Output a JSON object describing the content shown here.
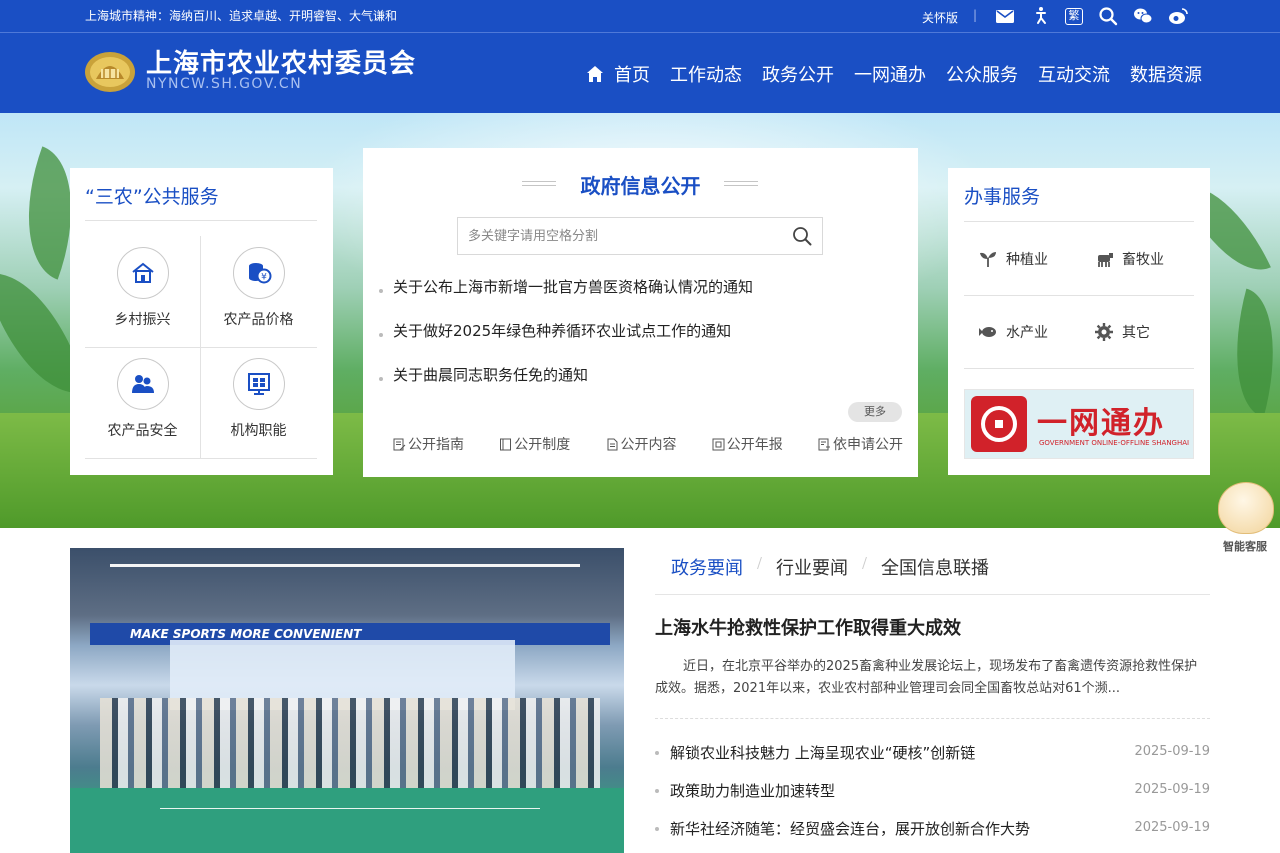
{
  "topbar": {
    "motto": "上海城市精神：海纳百川、追求卓越、开明睿智、大气谦和",
    "care_mode": "关怀版",
    "separator": "|",
    "traditional": "繁",
    "icons": [
      "mail-icon",
      "accessibility-icon",
      "traditional-chinese-icon",
      "search-icon",
      "wechat-icon",
      "weibo-icon"
    ]
  },
  "header": {
    "title": "上海市农业农村委员会",
    "subtitle": "NYNCW.SH.GOV.CN",
    "nav": [
      "首页",
      "工作动态",
      "政务公开",
      "一网通办",
      "公众服务",
      "互动交流",
      "数据资源"
    ]
  },
  "sannong": {
    "title": "“三农”公共服务",
    "items": [
      {
        "label": "乡村振兴",
        "icon": "village-icon"
      },
      {
        "label": "农产品价格",
        "icon": "price-icon"
      },
      {
        "label": "农产品安全",
        "icon": "safety-icon"
      },
      {
        "label": "机构职能",
        "icon": "organization-icon"
      }
    ]
  },
  "govinfo": {
    "title": "政府信息公开",
    "search_placeholder": "多关键字请用空格分割",
    "notices": [
      "关于公布上海市新增一批官方兽医资格确认情况的通知",
      "关于做好2025年绿色种养循环农业试点工作的通知",
      "关于曲晨同志职务任免的通知"
    ],
    "more": "更多",
    "links": [
      "公开指南",
      "公开制度",
      "公开内容",
      "公开年报",
      "依申请公开"
    ]
  },
  "banshi": {
    "title": "办事服务",
    "items": [
      {
        "label": "种植业",
        "icon": "sprout-icon"
      },
      {
        "label": "畜牧业",
        "icon": "livestock-icon"
      },
      {
        "label": "水产业",
        "icon": "fish-icon"
      },
      {
        "label": "其它",
        "icon": "gear-icon"
      }
    ],
    "banner_title": "一网通办",
    "banner_sub": "GOVERNMENT ONLINE-OFFLINE SHANGHAI"
  },
  "mascot": {
    "label": "智能客服"
  },
  "news": {
    "tabs": [
      "政务要闻",
      "行业要闻",
      "全国信息联播"
    ],
    "active_tab": 0,
    "headline": "上海水牛抢救性保护工作取得重大成效",
    "summary": "近日，在北京平谷举办的2025畜禽种业发展论坛上，现场发布了畜禽遗传资源抢救性保护成效。据悉，2021年以来，农业农村部种业管理司会同全国畜牧总站对61个濒...",
    "items": [
      {
        "title": "解锁农业科技魅力 上海呈现农业“硬核”创新链",
        "date": "2025-09-19"
      },
      {
        "title": "政策助力制造业加速转型",
        "date": "2025-09-19"
      },
      {
        "title": "新华社经济随笔：经贸盛会连台，展开放创新合作大势",
        "date": "2025-09-19"
      }
    ],
    "photo_banner": "MAKE SPORTS MORE CONVENIENT"
  },
  "colors": {
    "brand": "#1a4fc4",
    "accent_red": "#d1222a"
  }
}
